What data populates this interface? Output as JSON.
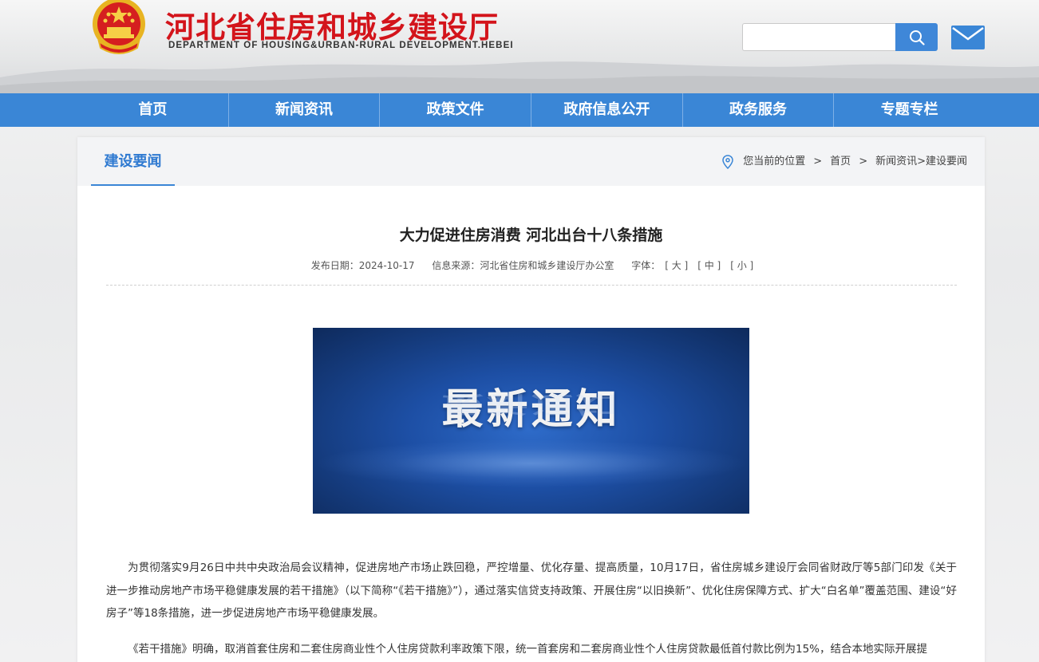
{
  "header": {
    "site_title": "河北省住房和城乡建设厅",
    "site_subtitle": "DEPARTMENT OF HOUSING&URBAN-RURAL DEVELOPMENT.HEBEI",
    "search_placeholder": ""
  },
  "nav": {
    "items": [
      "首页",
      "新闻资讯",
      "政策文件",
      "政府信息公开",
      "政务服务",
      "专题专栏"
    ]
  },
  "section": {
    "title": "建设要闻"
  },
  "breadcrumb": {
    "prefix": "您当前的位置",
    "sep": ">",
    "home": "首页",
    "trail": "新闻资讯>建设要闻"
  },
  "article": {
    "title": "大力促进住房消费 河北出台十八条措施",
    "date_label": "发布日期：2024-10-17",
    "source_label": "信息来源：河北省住房和城乡建设厅办公室",
    "font_label": "字体：",
    "font_large": "[ 大 ]",
    "font_medium": "[ 中 ]",
    "font_small": "[ 小 ]",
    "image_text": "最新通知",
    "paragraphs": [
      "为贯彻落实9月26日中共中央政治局会议精神，促进房地产市场止跌回稳，严控增量、优化存量、提高质量，10月17日，省住房城乡建设厅会同省财政厅等5部门印发《关于进一步推动房地产市场平稳健康发展的若干措施》（以下简称“《若干措施》”），通过落实信贷支持政策、开展住房“以旧换新”、优化住房保障方式、扩大“白名单”覆盖范围、建设“好房子”等18条措施，进一步促进房地产市场平稳健康发展。",
      "《若干措施》明确，取消首套住房和二套住房商业性个人住房贷款利率政策下限，统一首套房和二套房商业性个人住房贷款最低首付款比例为15%，结合本地实际开展提"
    ]
  },
  "colors": {
    "brand_red": "#d3141b",
    "nav_blue": "#3a86d6",
    "accent_blue": "#2f7ad1"
  }
}
